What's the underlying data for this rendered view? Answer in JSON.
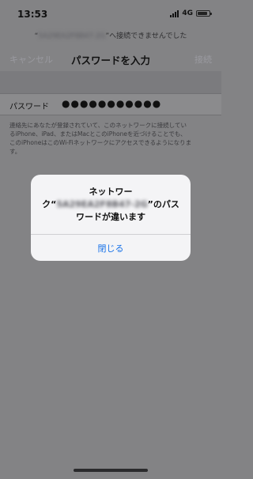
{
  "status_bar": {
    "time": "13:53",
    "network": "4G",
    "battery_level": 0.75,
    "signal_bars": 4
  },
  "prompt": {
    "quote_open": "“",
    "ssid": "5A29EA2F8B47-2G",
    "quote_close": "”",
    "suffix": "へ接続できませんでした"
  },
  "nav": {
    "cancel": "キャンセル",
    "title": "パスワードを入力",
    "join": "接続"
  },
  "password_row": {
    "label": "パスワード",
    "value": "●●●●●●●●●●●"
  },
  "help_lines": [
    "連絡先にあなたが登録されていて、このネットワークに接続してい",
    "るiPhone、iPad、またはMacとこのiPhoneを近づけることでも、",
    "このiPhoneはこのWi-Fiネットワークにアクセスできるようになりま",
    "す。"
  ],
  "alert": {
    "line1": "ネットワー",
    "line2_prefix": "ク“",
    "ssid": "5A29EA2F8B47-2G",
    "line2_suffix": "”のパス",
    "line3": "ワードが違います",
    "close_button": "閉じる"
  }
}
